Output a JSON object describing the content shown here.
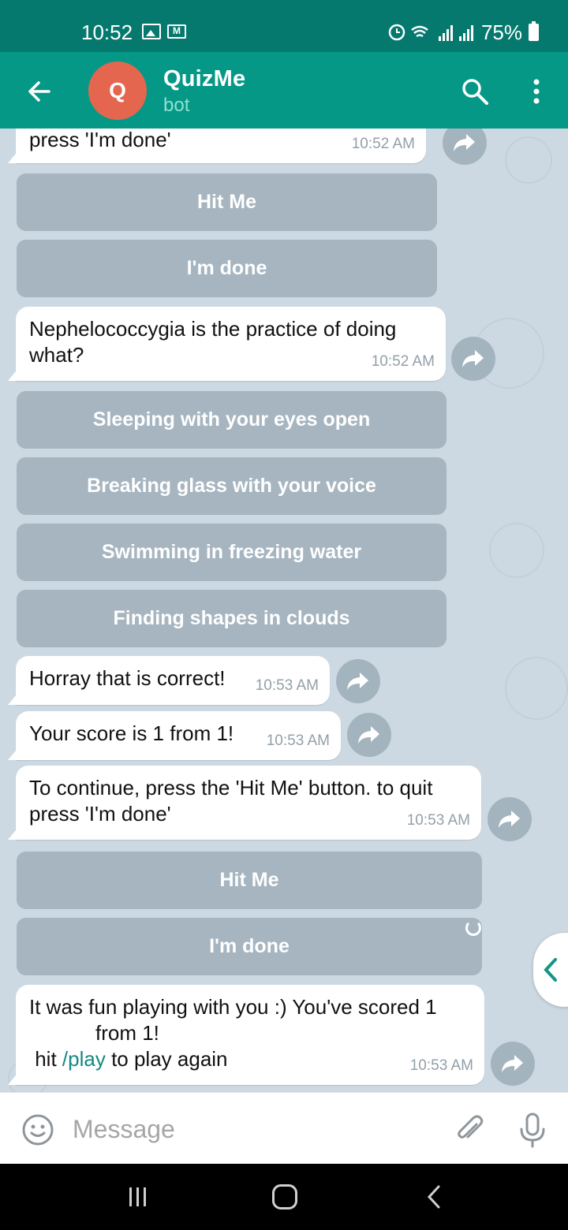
{
  "status_bar": {
    "time": "10:52",
    "battery": "75%"
  },
  "header": {
    "avatar_letter": "Q",
    "title": "QuizMe",
    "subtitle": "bot"
  },
  "messages": [
    {
      "text": "press 'I'm done'",
      "time": "10:52 AM"
    },
    {
      "text": "Nephelococcygia is the practice of doing what?",
      "time": "10:52 AM"
    },
    {
      "text": "Horray that is correct!",
      "time": "10:53 AM"
    },
    {
      "text": "Your score is 1 from 1!",
      "time": "10:53 AM"
    },
    {
      "text": "To continue, press the 'Hit Me' button. to quit press 'I'm done'",
      "time": "10:53 AM"
    },
    {
      "line1": "It was fun playing with you :) You've scored 1",
      "line2": "from 1!",
      "line3_prefix": " hit ",
      "line3_link": "/play",
      "line3_suffix": " to play again",
      "time": "10:53 AM"
    }
  ],
  "keyboards": {
    "first": [
      "Hit Me",
      "I'm done"
    ],
    "answers": [
      "Sleeping with your eyes open",
      "Breaking glass with your voice",
      "Swimming in freezing water",
      "Finding shapes in clouds"
    ],
    "second": [
      "Hit Me",
      "I'm done"
    ]
  },
  "input": {
    "placeholder": "Message"
  },
  "icons": [
    "back-arrow-icon",
    "search-icon",
    "more-vert-icon",
    "forward-icon",
    "emoji-icon",
    "attach-icon",
    "mic-icon",
    "chevron-left-icon"
  ],
  "colors": {
    "status_bar": "#06796e",
    "app_bar": "#069886",
    "avatar": "#e4664f",
    "link": "#138a80"
  }
}
